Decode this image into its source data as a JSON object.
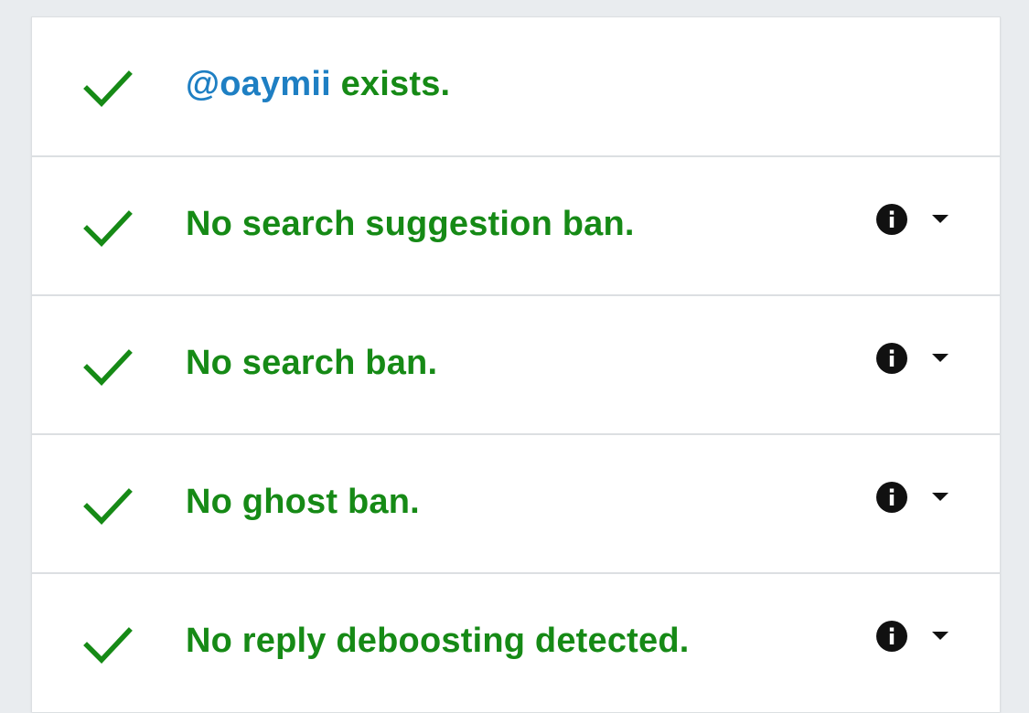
{
  "colors": {
    "success": "#168a16",
    "link": "#1e7fc3",
    "page_bg": "#e9ecef",
    "card_bg": "#ffffff",
    "icon": "#111111"
  },
  "rows": [
    {
      "icon": "check-icon",
      "handle": "@oaymii",
      "text": " exists.",
      "has_info": false
    },
    {
      "icon": "check-icon",
      "text": "No search suggestion ban.",
      "has_info": true,
      "info_icon": "info-icon",
      "toggle_icon": "caret-down-icon"
    },
    {
      "icon": "check-icon",
      "text": "No search ban.",
      "has_info": true,
      "info_icon": "info-icon",
      "toggle_icon": "caret-down-icon"
    },
    {
      "icon": "check-icon",
      "text": "No ghost ban.",
      "has_info": true,
      "info_icon": "info-icon",
      "toggle_icon": "caret-down-icon"
    },
    {
      "icon": "check-icon",
      "text": "No reply deboosting detected.",
      "has_info": true,
      "info_icon": "info-icon",
      "toggle_icon": "caret-down-icon"
    }
  ]
}
